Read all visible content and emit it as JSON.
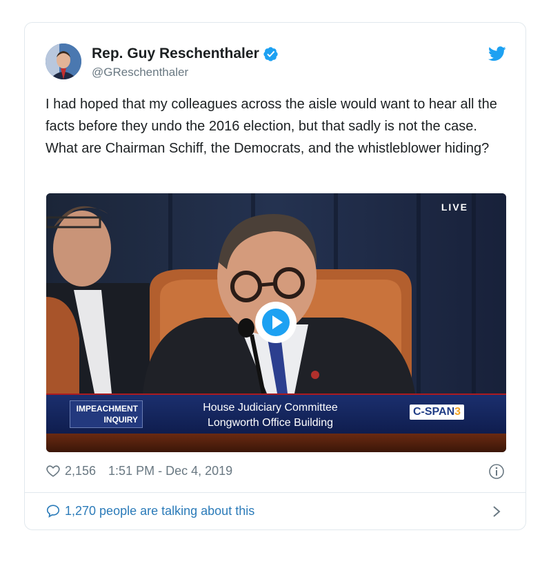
{
  "tweet": {
    "author_name": "Rep. Guy Reschenthaler",
    "author_handle": "@GReschenthaler",
    "text": "I had hoped that my colleagues across the aisle would want to hear all the facts before they undo the 2016 election, but that sadly is not the case. What are Chairman Schiff, the Democrats, and the whistleblower hiding?",
    "likes": "2,156",
    "timestamp": "1:51 PM - Dec 4, 2019",
    "talking": "1,270 people are talking about this"
  },
  "video": {
    "live_label": "LIVE",
    "banner_left_line1": "IMPEACHMENT",
    "banner_left_line2": "INQUIRY",
    "banner_center_line1": "House Judiciary Committee",
    "banner_center_line2": "Longworth Office Building",
    "network": "C-SPAN",
    "network_number": "3"
  },
  "colors": {
    "twitter_blue": "#1da1f2",
    "link_blue": "#2b7bb9",
    "muted_text": "#697882"
  },
  "icons": [
    "verified-icon",
    "twitter-bird-icon",
    "play-icon",
    "heart-icon",
    "info-icon",
    "reply-bubble-icon",
    "chevron-right-icon"
  ]
}
